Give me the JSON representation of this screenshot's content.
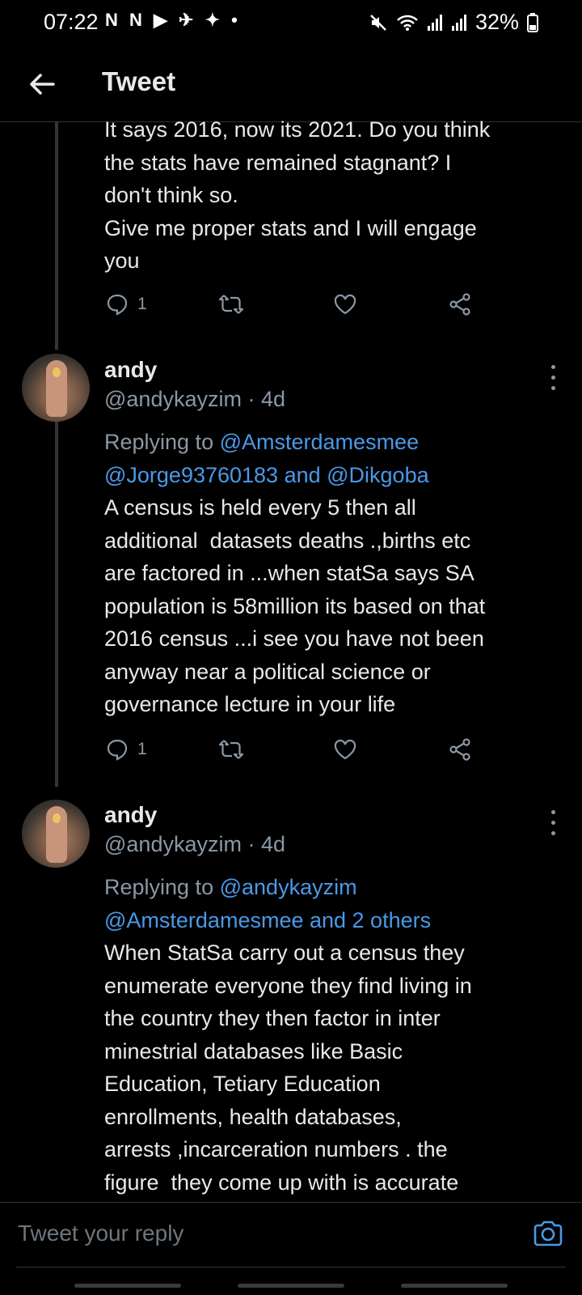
{
  "status": {
    "time": "07:22",
    "notif_icons": "N N ▶ ✈ ✦ •",
    "battery": "32%"
  },
  "header": {
    "title": "Tweet"
  },
  "tweets": [
    {
      "text": "It says 2016, now its 2021. Do you think\nthe stats have remained stagnant? I\ndon't think so.\nGive me proper stats and I will engage\nyou",
      "reply_count": "1"
    },
    {
      "name": "andy",
      "handle_time": "@andykayzim · 4d",
      "replying_label": "Replying to",
      "replying_line1": "@Amsterdamesmee",
      "replying_line2": "@Jorge93760183 and @Dikgoba",
      "text": "A census is held every 5 then all\nadditional  datasets deaths .,births etc\nare factored in ...when statSa says SA\npopulation is 58million its based on that\n2016 census ...i see you have not been\nanyway near a political science or\ngovernance lecture in your life",
      "reply_count": "1"
    },
    {
      "name": "andy",
      "handle_time": "@andykayzim · 4d",
      "replying_label": "Replying to",
      "replying_line1": "@andykayzim",
      "replying_line2": "@Amsterdamesmee and 2 others",
      "text": "When StatSa carry out a census they\nenumerate everyone they find living in\nthe country they then factor in inter\nminestrial databases like Basic\nEducation, Tetiary Education\nenrollments, health databases,\narrests ,incarceration numbers . the\nfigure  they come up with is accurate"
    }
  ],
  "composer": {
    "placeholder": "Tweet your reply"
  },
  "colors": {
    "background": "#000000",
    "link": "#4a99e9",
    "muted": "#8b98a5"
  }
}
